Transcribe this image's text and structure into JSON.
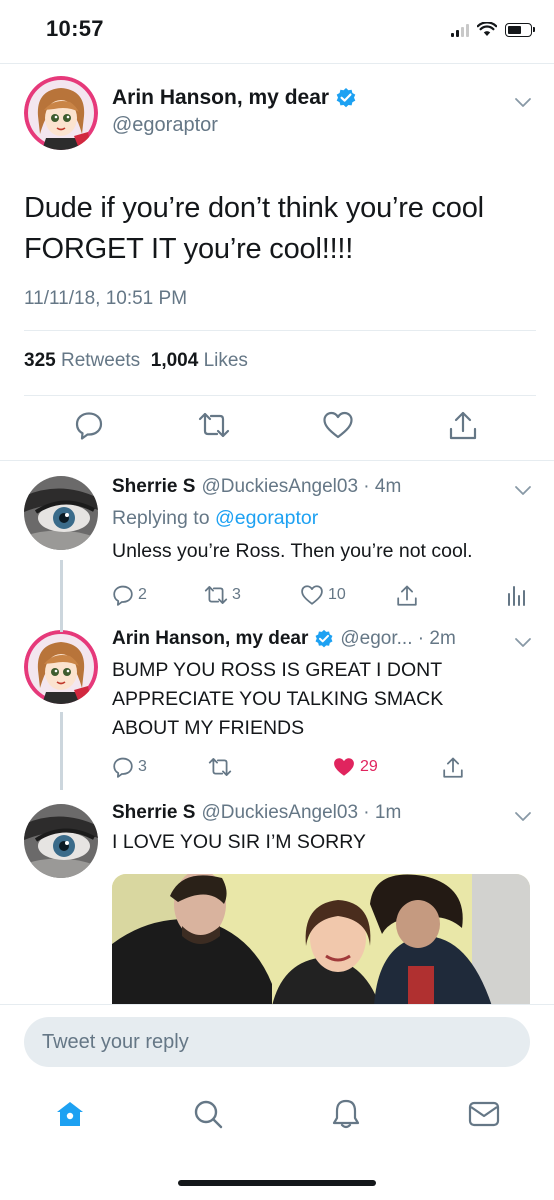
{
  "status_bar": {
    "time": "10:57"
  },
  "main_tweet": {
    "author_name": "Arin Hanson, my dear",
    "handle": "@egoraptor",
    "text": "Dude if you’re don’t think you’re cool FORGET IT you’re cool!!!!",
    "timestamp": "11/11/18, 10:51 PM",
    "retweets_count": "325",
    "retweets_label": "Retweets",
    "likes_count": "1,004",
    "likes_label": "Likes"
  },
  "replies": [
    {
      "name": "Sherrie S",
      "meta": "@DuckiesAngel03 · 4m",
      "replying_prefix": "Replying to",
      "replying_handle": "@egoraptor",
      "text": "Unless you’re Ross. Then you’re not cool.",
      "reply_count": "2",
      "retweet_count": "3",
      "like_count": "10"
    },
    {
      "name": "Arin Hanson, my dear",
      "meta": "@egor... · 2m",
      "text_lines": [
        "BUMP YOU ROSS IS GREAT I DONT",
        "APPRECIATE YOU TALKING SMACK",
        "ABOUT MY FRIENDS"
      ],
      "reply_count": "3",
      "like_count": "29"
    },
    {
      "name": "Sherrie S",
      "meta": "@DuckiesAngel03 · 1m",
      "text": "I LOVE YOU SIR I’M SORRY"
    }
  ],
  "reply_bar": {
    "placeholder": "Tweet your reply"
  },
  "colors": {
    "accent": "#1da1f2",
    "like_red": "#e0245e",
    "secondary_text": "#657786",
    "divider": "#e6ecf0"
  },
  "icons": {
    "tab_bar": [
      "home-icon",
      "search-icon",
      "notifications-icon",
      "messages-icon"
    ],
    "tweet_actions": [
      "reply-icon",
      "retweet-icon",
      "like-icon",
      "share-icon"
    ],
    "analytics": "analytics-icon"
  }
}
